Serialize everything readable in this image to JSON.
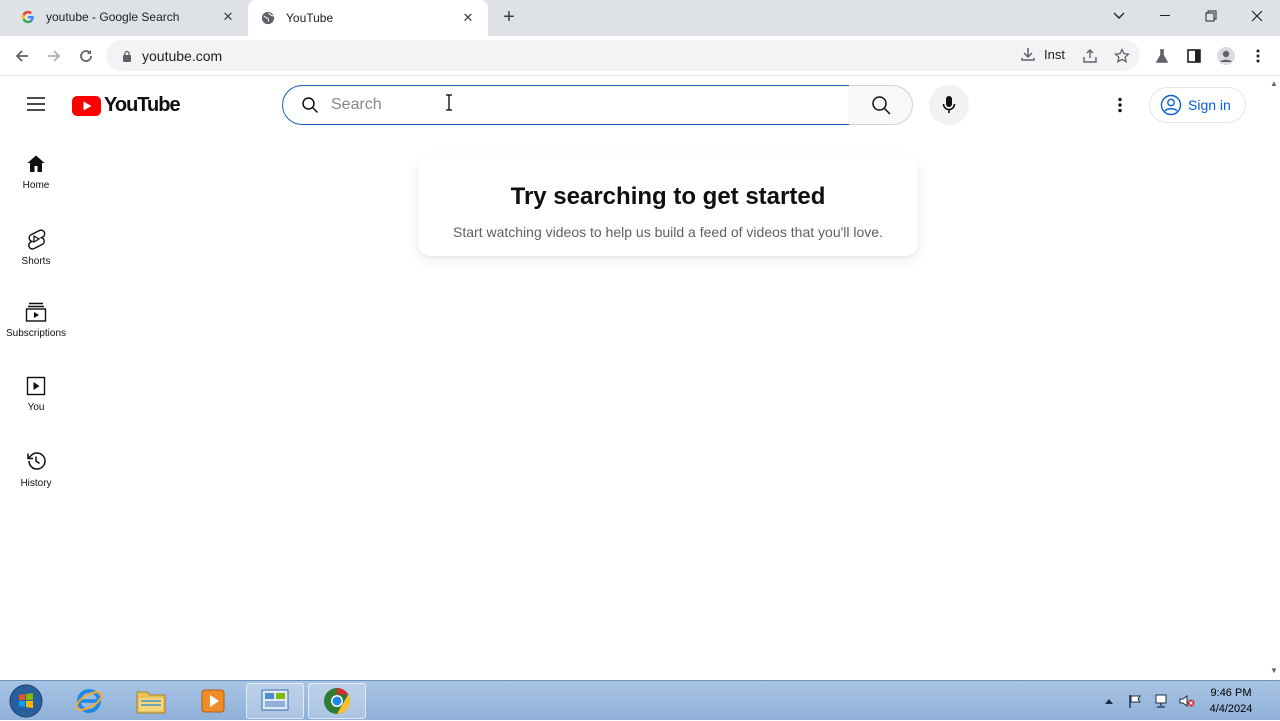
{
  "browser": {
    "tabs": [
      {
        "title": "youtube - Google Search",
        "favicon": "google-g-icon",
        "active": false
      },
      {
        "title": "YouTube",
        "favicon": "globe-icon",
        "active": true
      }
    ],
    "address": "youtube.com",
    "install_label": "Inst"
  },
  "youtube": {
    "logo_text": "YouTube",
    "search_placeholder": "Search",
    "search_value": "",
    "sign_in_label": "Sign in",
    "brand_red": "#ff0000",
    "link_blue": "#065fd4",
    "sidebar": [
      {
        "label": "Home",
        "icon": "home-icon"
      },
      {
        "label": "Shorts",
        "icon": "shorts-icon"
      },
      {
        "label": "Subscriptions",
        "icon": "subscriptions-icon"
      },
      {
        "label": "You",
        "icon": "you-library-icon"
      },
      {
        "label": "History",
        "icon": "history-icon"
      }
    ],
    "prompt": {
      "title": "Try searching to get started",
      "subtitle": "Start watching videos to help us build a feed of videos that you'll love."
    }
  },
  "taskbar": {
    "apps": [
      "internet-explorer-icon",
      "file-explorer-icon",
      "media-player-icon",
      "control-panel-icon",
      "chrome-icon"
    ],
    "time": "9:46 PM",
    "date": "4/4/2024"
  }
}
